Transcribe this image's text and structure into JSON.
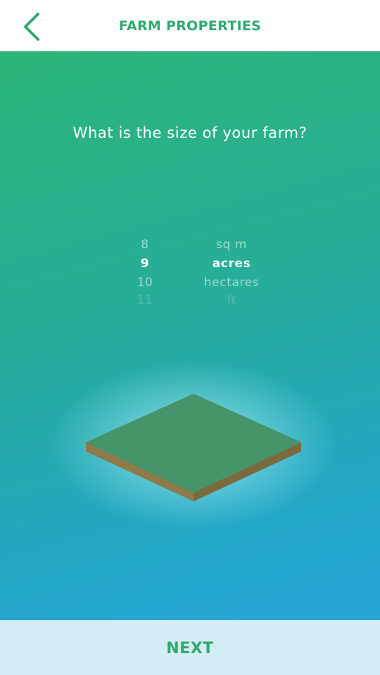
{
  "header": {
    "title": "FARM PROPERTIES",
    "back_icon": "chevron-left-icon"
  },
  "main": {
    "question": "What is the size of your farm?",
    "size_picker": {
      "items": [
        "8",
        "9",
        "10",
        "11"
      ],
      "selected_value": "9"
    },
    "unit_picker": {
      "items": [
        "sq m",
        "acres",
        "hectares",
        "ft"
      ],
      "selected_value": "acres"
    },
    "illustration": "farm-land-tile-icon"
  },
  "footer": {
    "next_label": "NEXT"
  },
  "colors": {
    "accent": "#2eaa6e",
    "gradient_start": "#2cb578",
    "gradient_end": "#25a6d8",
    "footer_bg": "#d4ecf4",
    "land_top": "#46956a",
    "land_side": "#8e7a4a"
  }
}
